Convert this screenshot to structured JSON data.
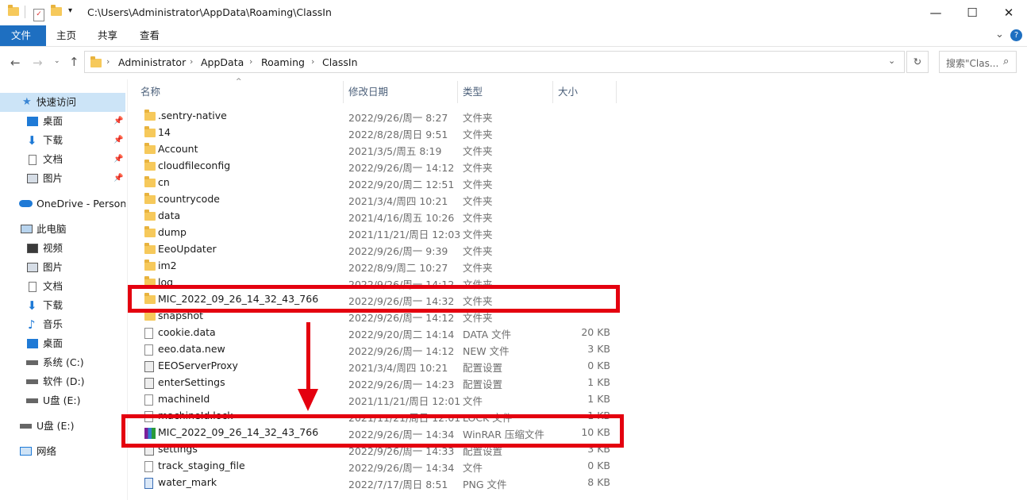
{
  "window": {
    "title_path": "C:\\Users\\Administrator\\AppData\\Roaming\\ClassIn",
    "minimize": "—",
    "maximize": "☐",
    "close": "✕"
  },
  "ribbon": {
    "tabs": [
      "文件",
      "主页",
      "共享",
      "查看"
    ],
    "expand": "⌄",
    "help": "?"
  },
  "address": {
    "crumbs": [
      "Administrator",
      "AppData",
      "Roaming",
      "ClassIn"
    ],
    "search_placeholder": "搜索\"Clas..."
  },
  "sidebar": {
    "items": [
      {
        "label": "快速访问",
        "icon": "star-icon"
      },
      {
        "label": "桌面",
        "icon": "desktop-icon",
        "pinned": true
      },
      {
        "label": "下载",
        "icon": "download-icon",
        "pinned": true
      },
      {
        "label": "文档",
        "icon": "document-icon",
        "pinned": true
      },
      {
        "label": "图片",
        "icon": "picture-icon",
        "pinned": true
      },
      {
        "label": "OneDrive - Persona",
        "icon": "cloud-icon"
      },
      {
        "label": "此电脑",
        "icon": "computer-icon"
      },
      {
        "label": "视频",
        "icon": "video-icon"
      },
      {
        "label": "图片",
        "icon": "picture-icon"
      },
      {
        "label": "文档",
        "icon": "document-icon"
      },
      {
        "label": "下载",
        "icon": "download-icon"
      },
      {
        "label": "音乐",
        "icon": "music-icon"
      },
      {
        "label": "桌面",
        "icon": "desktop-icon"
      },
      {
        "label": "系统 (C:)",
        "icon": "drive-icon"
      },
      {
        "label": "软件 (D:)",
        "icon": "drive-icon"
      },
      {
        "label": "U盘 (E:)",
        "icon": "usb-drive-icon"
      },
      {
        "label": "U盘 (E:)",
        "icon": "usb-drive-icon"
      },
      {
        "label": "网络",
        "icon": "network-icon"
      }
    ]
  },
  "columns": {
    "name": "名称",
    "date": "修改日期",
    "type": "类型",
    "size": "大小"
  },
  "files": [
    {
      "name": ".sentry-native",
      "date": "2022/9/26/周一 8:27",
      "type": "文件夹",
      "size": "",
      "kind": "folder"
    },
    {
      "name": "14",
      "date": "2022/8/28/周日 9:51",
      "type": "文件夹",
      "size": "",
      "kind": "folder"
    },
    {
      "name": "Account",
      "date": "2021/3/5/周五 8:19",
      "type": "文件夹",
      "size": "",
      "kind": "folder"
    },
    {
      "name": "cloudfileconfig",
      "date": "2022/9/26/周一 14:12",
      "type": "文件夹",
      "size": "",
      "kind": "folder"
    },
    {
      "name": "cn",
      "date": "2022/9/20/周二 12:51",
      "type": "文件夹",
      "size": "",
      "kind": "folder"
    },
    {
      "name": "countrycode",
      "date": "2021/3/4/周四 10:21",
      "type": "文件夹",
      "size": "",
      "kind": "folder"
    },
    {
      "name": "data",
      "date": "2021/4/16/周五 10:26",
      "type": "文件夹",
      "size": "",
      "kind": "folder"
    },
    {
      "name": "dump",
      "date": "2021/11/21/周日 12:03",
      "type": "文件夹",
      "size": "",
      "kind": "folder"
    },
    {
      "name": "EeoUpdater",
      "date": "2022/9/26/周一 9:39",
      "type": "文件夹",
      "size": "",
      "kind": "folder"
    },
    {
      "name": "im2",
      "date": "2022/8/9/周二 10:27",
      "type": "文件夹",
      "size": "",
      "kind": "folder"
    },
    {
      "name": "log",
      "date": "2022/9/26/周一 14:12",
      "type": "文件夹",
      "size": "",
      "kind": "folder"
    },
    {
      "name": "MIC_2022_09_26_14_32_43_766",
      "date": "2022/9/26/周一 14:32",
      "type": "文件夹",
      "size": "",
      "kind": "folder"
    },
    {
      "name": "snapshot",
      "date": "2022/9/26/周一 14:12",
      "type": "文件夹",
      "size": "",
      "kind": "folder"
    },
    {
      "name": "cookie.data",
      "date": "2022/9/20/周二 14:14",
      "type": "DATA 文件",
      "size": "20 KB",
      "kind": "file"
    },
    {
      "name": "eeo.data.new",
      "date": "2022/9/26/周一 14:12",
      "type": "NEW 文件",
      "size": "3 KB",
      "kind": "file"
    },
    {
      "name": "EEOServerProxy",
      "date": "2021/3/4/周四 10:21",
      "type": "配置设置",
      "size": "0 KB",
      "kind": "config"
    },
    {
      "name": "enterSettings",
      "date": "2022/9/26/周一 14:23",
      "type": "配置设置",
      "size": "1 KB",
      "kind": "config"
    },
    {
      "name": "machineId",
      "date": "2021/11/21/周日 12:01",
      "type": "文件",
      "size": "1 KB",
      "kind": "file"
    },
    {
      "name": "machineId.lock",
      "date": "2021/11/21/周日 12:01",
      "type": "LOCK 文件",
      "size": "1 KB",
      "kind": "file"
    },
    {
      "name": "MIC_2022_09_26_14_32_43_766",
      "date": "2022/9/26/周一 14:34",
      "type": "WinRAR 压缩文件",
      "size": "10 KB",
      "kind": "rar"
    },
    {
      "name": "settings",
      "date": "2022/9/26/周一 14:33",
      "type": "配置设置",
      "size": "3 KB",
      "kind": "config"
    },
    {
      "name": "track_staging_file",
      "date": "2022/9/26/周一 14:34",
      "type": "文件",
      "size": "0 KB",
      "kind": "file"
    },
    {
      "name": "water_mark",
      "date": "2022/7/17/周日 8:51",
      "type": "PNG 文件",
      "size": "8 KB",
      "kind": "png"
    }
  ],
  "colors": {
    "accent": "#1e6fc1",
    "highlight": "#e4000f",
    "selected": "#cce4f7"
  }
}
